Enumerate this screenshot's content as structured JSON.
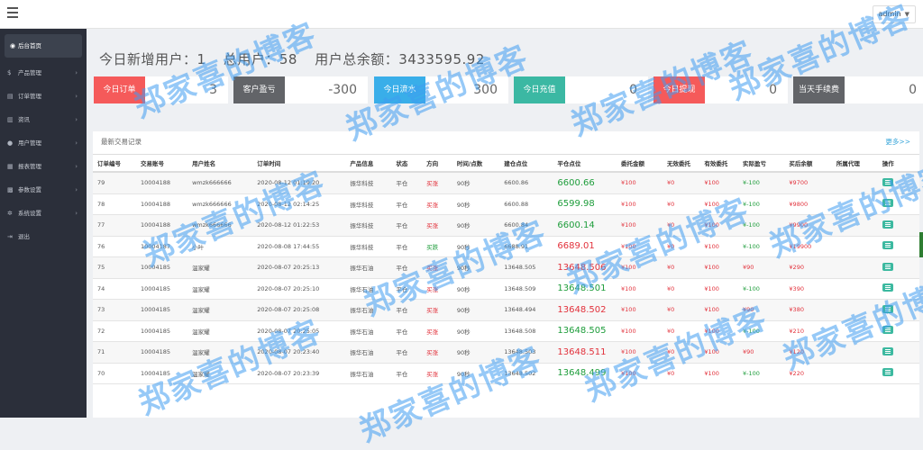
{
  "topbar": {
    "user": "admin"
  },
  "sidebar": {
    "items": [
      {
        "label": "后台首页",
        "icon": "dashboard-icon",
        "active": true
      },
      {
        "label": "产品管理",
        "icon": "dollar-icon"
      },
      {
        "label": "订单管理",
        "icon": "order-icon"
      },
      {
        "label": "资讯",
        "icon": "news-icon"
      },
      {
        "label": "用户管理",
        "icon": "user-icon"
      },
      {
        "label": "报表管理",
        "icon": "report-icon"
      },
      {
        "label": "参数设置",
        "icon": "params-icon"
      },
      {
        "label": "系统设置",
        "icon": "gear-icon"
      },
      {
        "label": "退出",
        "icon": "logout-icon"
      }
    ]
  },
  "stats": {
    "new_users": "今日新增用户：1",
    "total_users": "总用户：58",
    "total_balance": "用户总余额：3433595.92"
  },
  "cards": [
    {
      "label": "今日订单",
      "value": "3",
      "color": "#f55a5a"
    },
    {
      "label": "客户盈亏",
      "value": "-300",
      "color": "#626468"
    },
    {
      "label": "今日流水",
      "value": "300",
      "color": "#39aee9"
    },
    {
      "label": "今日充值",
      "value": "0",
      "color": "#3bb8a3"
    },
    {
      "label": "今日提现",
      "value": "0",
      "color": "#f55a5a"
    },
    {
      "label": "当天手续费",
      "value": "0",
      "color": "#626468"
    }
  ],
  "table": {
    "title": "最新交易记录",
    "more": "更多>>",
    "headers": [
      "订单编号",
      "交易账号",
      "用户姓名",
      "订单时间",
      "产品信息",
      "状态",
      "方向",
      "时间/点数",
      "建仓点位",
      "平仓点位",
      "委托金额",
      "无效委托",
      "有效委托",
      "实际盈亏",
      "买后余额",
      "所属代理",
      "操作"
    ],
    "rows": [
      {
        "id": "79",
        "account": "10004188",
        "name": "wmzk666666",
        "time": "2020-08-12 01:19:20",
        "product": "振华科技",
        "status": "平仓",
        "dir": "买涨",
        "dur": "90秒",
        "open": "6600.86",
        "close": "6600.66",
        "amount": "¥100",
        "invalid": "¥0",
        "valid": "¥100",
        "pnl": "¥-100",
        "balance": "¥9700",
        "agent": ""
      },
      {
        "id": "78",
        "account": "10004188",
        "name": "wmzk666666",
        "time": "2020-08-12 02:14:25",
        "product": "振华科技",
        "status": "平仓",
        "dir": "买涨",
        "dur": "90秒",
        "open": "6600.88",
        "close": "6599.98",
        "amount": "¥100",
        "invalid": "¥0",
        "valid": "¥100",
        "pnl": "¥-100",
        "balance": "¥9800",
        "agent": ""
      },
      {
        "id": "77",
        "account": "10004188",
        "name": "wmzk666666",
        "time": "2020-08-12 01:22:53",
        "product": "振华科技",
        "status": "平仓",
        "dir": "买涨",
        "dur": "90秒",
        "open": "6600.84",
        "close": "6600.14",
        "amount": "¥100",
        "invalid": "¥0",
        "valid": "¥100",
        "pnl": "¥-100",
        "balance": "¥9900",
        "agent": ""
      },
      {
        "id": "76",
        "account": "10004187",
        "name": "小叶",
        "time": "2020-08-08 17:44:55",
        "product": "振华科技",
        "status": "平仓",
        "dir": "买跌",
        "dur": "90秒",
        "open": "6688.91",
        "close": "6689.01",
        "amount": "¥100",
        "invalid": "¥0",
        "valid": "¥100",
        "pnl": "¥-100",
        "balance": "¥19900",
        "agent": ""
      },
      {
        "id": "75",
        "account": "10004185",
        "name": "温家耀",
        "time": "2020-08-07 20:25:13",
        "product": "振华石油",
        "status": "平仓",
        "dir": "买涨",
        "dur": "90秒",
        "open": "13648.505",
        "close": "13648.506",
        "amount": "¥100",
        "invalid": "¥0",
        "valid": "¥100",
        "pnl": "¥90",
        "balance": "¥290",
        "agent": ""
      },
      {
        "id": "74",
        "account": "10004185",
        "name": "温家耀",
        "time": "2020-08-07 20:25:10",
        "product": "振华石油",
        "status": "平仓",
        "dir": "买涨",
        "dur": "90秒",
        "open": "13648.509",
        "close": "13648.501",
        "amount": "¥100",
        "invalid": "¥0",
        "valid": "¥100",
        "pnl": "¥-100",
        "balance": "¥390",
        "agent": ""
      },
      {
        "id": "73",
        "account": "10004185",
        "name": "温家耀",
        "time": "2020-08-07 20:25:08",
        "product": "振华石油",
        "status": "平仓",
        "dir": "买涨",
        "dur": "90秒",
        "open": "13648.494",
        "close": "13648.502",
        "amount": "¥100",
        "invalid": "¥0",
        "valid": "¥100",
        "pnl": "¥90",
        "balance": "¥380",
        "agent": ""
      },
      {
        "id": "72",
        "account": "10004185",
        "name": "温家耀",
        "time": "2020-08-07 20:25:05",
        "product": "振华石油",
        "status": "平仓",
        "dir": "买涨",
        "dur": "90秒",
        "open": "13648.508",
        "close": "13648.505",
        "amount": "¥100",
        "invalid": "¥0",
        "valid": "¥100",
        "pnl": "¥-100",
        "balance": "¥210",
        "agent": ""
      },
      {
        "id": "71",
        "account": "10004185",
        "name": "温家耀",
        "time": "2020-08-07 20:23:40",
        "product": "振华石油",
        "status": "平仓",
        "dir": "买涨",
        "dur": "90秒",
        "open": "13648.503",
        "close": "13648.511",
        "amount": "¥100",
        "invalid": "¥0",
        "valid": "¥100",
        "pnl": "¥90",
        "balance": "¥120",
        "agent": ""
      },
      {
        "id": "70",
        "account": "10004185",
        "name": "温家耀",
        "time": "2020-08-07 20:23:39",
        "product": "振华石油",
        "status": "平仓",
        "dir": "买涨",
        "dur": "90秒",
        "open": "13648.502",
        "close": "13648.499",
        "amount": "¥100",
        "invalid": "¥0",
        "valid": "¥100",
        "pnl": "¥-100",
        "balance": "¥220",
        "agent": ""
      }
    ]
  },
  "watermark": "郑家喜的博客"
}
